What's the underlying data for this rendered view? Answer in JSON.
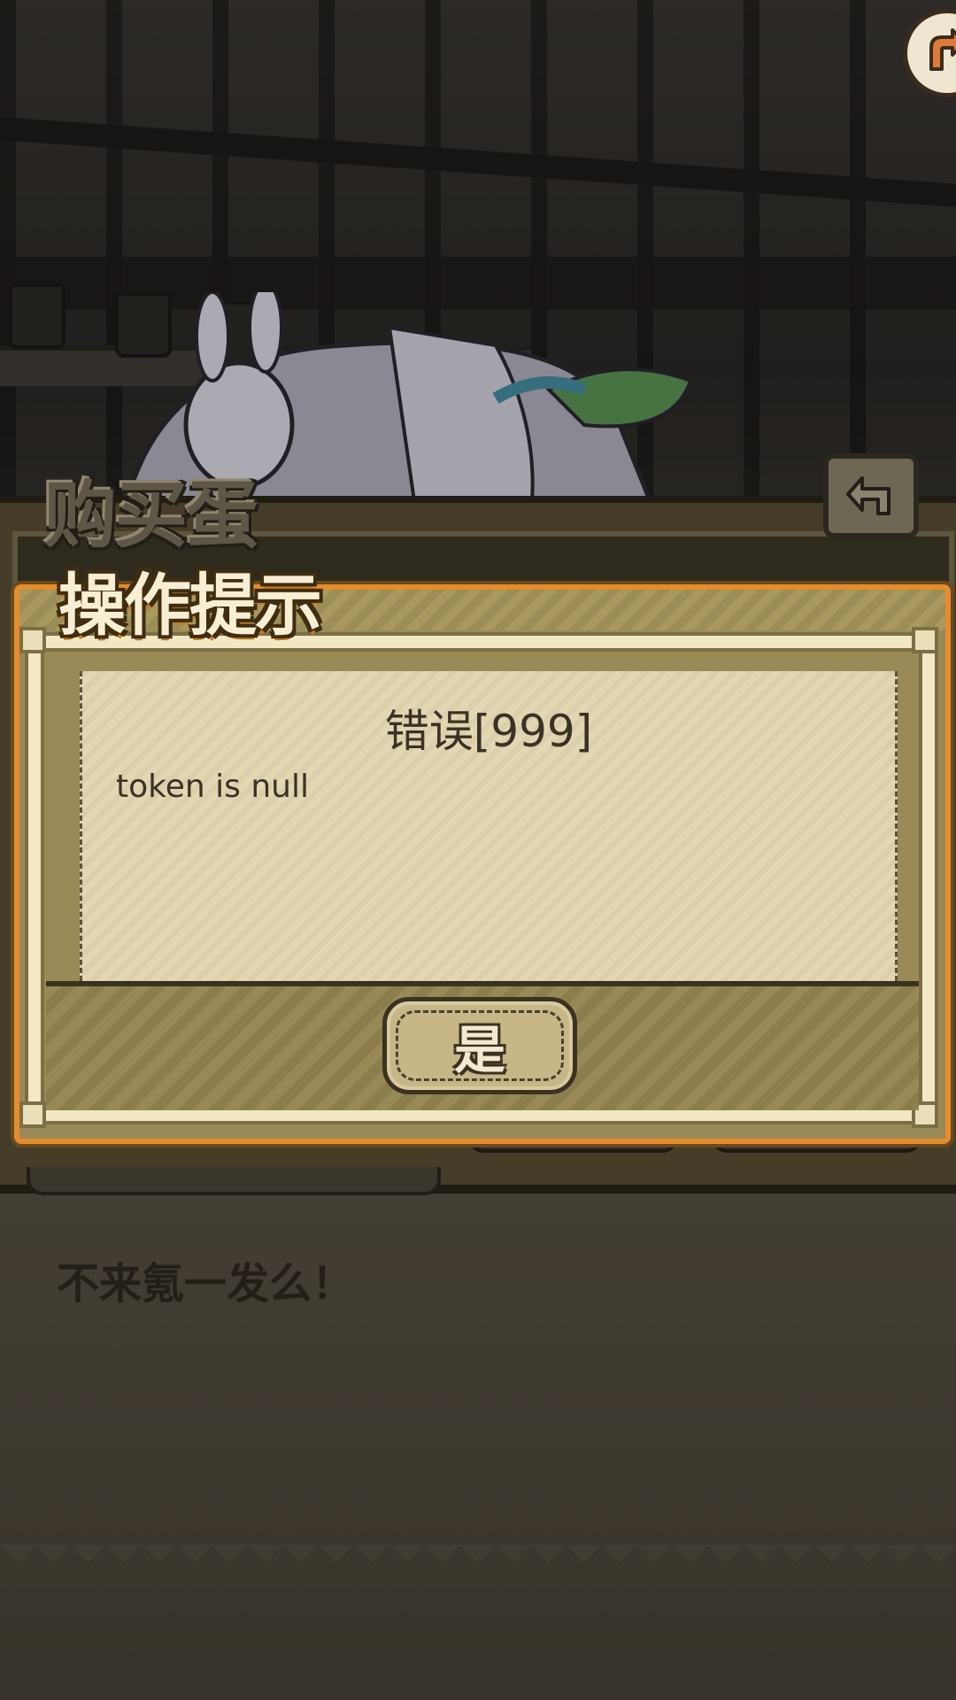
{
  "back_panel": {
    "title": "购买蛋",
    "return_icon": "return-arrow-icon"
  },
  "dialog": {
    "title": "操作提示",
    "error_title": "错误[999]",
    "message": "token is null",
    "confirm_label": "是"
  },
  "promo": {
    "text": "不来氪一发么！"
  },
  "corner_button": {
    "icon": "skip-arrow-icon"
  },
  "colors": {
    "dialog_border": "#e58c2c",
    "content_bg": "#e1d7b2",
    "frame_cream": "#f2e8c4"
  }
}
